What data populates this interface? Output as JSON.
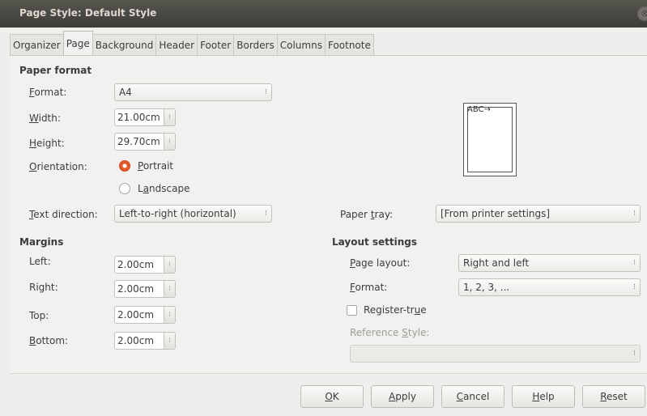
{
  "window": {
    "title": "Page Style: Default Style",
    "close_glyph": "⊗"
  },
  "tabs": [
    {
      "label": "Organizer"
    },
    {
      "label": "Page"
    },
    {
      "label": "Background"
    },
    {
      "label": "Header"
    },
    {
      "label": "Footer"
    },
    {
      "label": "Borders"
    },
    {
      "label": "Columns"
    },
    {
      "label": "Footnote"
    }
  ],
  "active_tab": "Page",
  "paper_format": {
    "heading": "Paper format",
    "format_label_u": "F",
    "format_label_rest": "ormat:",
    "format_value": "A4",
    "width_label_u": "W",
    "width_label_rest": "idth:",
    "width_value": "21.00cm",
    "height_label_u": "H",
    "height_label_rest": "eight:",
    "height_value": "29.70cm",
    "orientation_label_u": "O",
    "orientation_label_rest": "rientation:",
    "portrait_u": "P",
    "portrait_rest": "ortrait",
    "landscape_pre": "L",
    "landscape_u": "a",
    "landscape_rest": "ndscape",
    "orientation_selected": "Portrait",
    "text_direction_label_u": "T",
    "text_direction_label_rest": "ext direction:",
    "text_direction_value": "Left-to-right (horizontal)",
    "paper_tray_label_pre": "Paper ",
    "paper_tray_label_u": "t",
    "paper_tray_label_rest": "ray:",
    "paper_tray_value": "[From printer settings]"
  },
  "preview": {
    "text": "ABC→"
  },
  "margins": {
    "heading": "Margins",
    "left_label": "Left:",
    "left_value": "2.00cm",
    "right_label": "Right:",
    "right_value": "2.00cm",
    "top_label": "Top:",
    "top_value": "2.00cm",
    "bottom_label_u": "B",
    "bottom_label_rest": "ottom:",
    "bottom_value": "2.00cm"
  },
  "layout_settings": {
    "heading": "Layout settings",
    "page_layout_label_u": "P",
    "page_layout_label_rest": "age layout:",
    "page_layout_value": "Right and left",
    "format_label_u": "F",
    "format_label_rest": "ormat:",
    "format_value": "1, 2, 3, ...",
    "register_true_pre": "Register-tr",
    "register_true_u": "u",
    "register_true_rest": "e",
    "register_true_checked": false,
    "reference_style_label_pre": "Reference ",
    "reference_style_label_u": "S",
    "reference_style_label_rest": "tyle:",
    "reference_style_value": ""
  },
  "buttons": {
    "ok_u": "O",
    "ok_rest": "K",
    "apply_u": "A",
    "apply_rest": "pply",
    "cancel_u": "C",
    "cancel_rest": "ancel",
    "help_u": "H",
    "help_rest": "elp",
    "reset_u": "R",
    "reset_rest": "eset"
  },
  "glyphs": {
    "spin": "⁝",
    "combo": "⁝"
  },
  "colors": {
    "accent": "#e05a2b",
    "titlebar": "#3c3b37",
    "dialog_bg": "#f2f1ef"
  }
}
